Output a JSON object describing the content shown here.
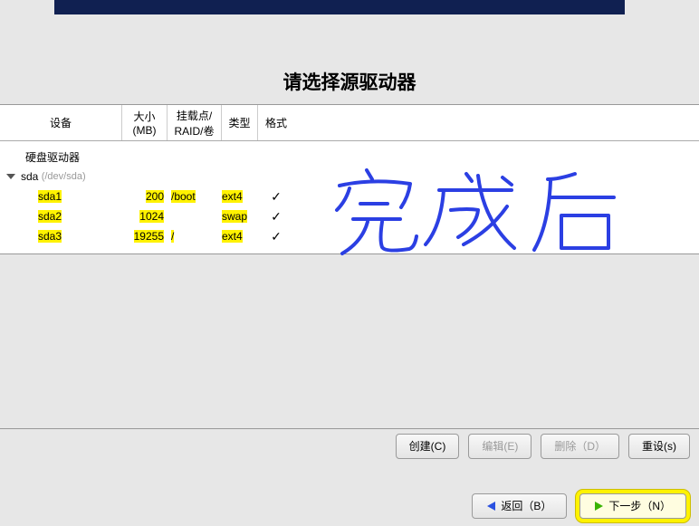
{
  "title": "请选择源驱动器",
  "columns": {
    "device": "设备",
    "size": "大小\n(MB)",
    "mount": "挂载点/\nRAID/卷",
    "type": "类型",
    "format": "格式"
  },
  "group_label": "硬盘驱动器",
  "disk": {
    "name": "sda",
    "path": "(/dev/sda)"
  },
  "parts": [
    {
      "name": "sda1",
      "size": "200",
      "mount": "/boot",
      "type": "ext4",
      "fmt": "✓"
    },
    {
      "name": "sda2",
      "size": "1024",
      "mount": "",
      "type": "swap",
      "fmt": "✓"
    },
    {
      "name": "sda3",
      "size": "19255",
      "mount": "/",
      "type": "ext4",
      "fmt": "✓"
    }
  ],
  "buttons": {
    "create": "创建(C)",
    "edit": "编辑(E)",
    "delete": "删除（D）",
    "reset": "重设(s)",
    "back": "返回（B）",
    "next": "下一步（N）"
  },
  "handwriting": "完成后"
}
